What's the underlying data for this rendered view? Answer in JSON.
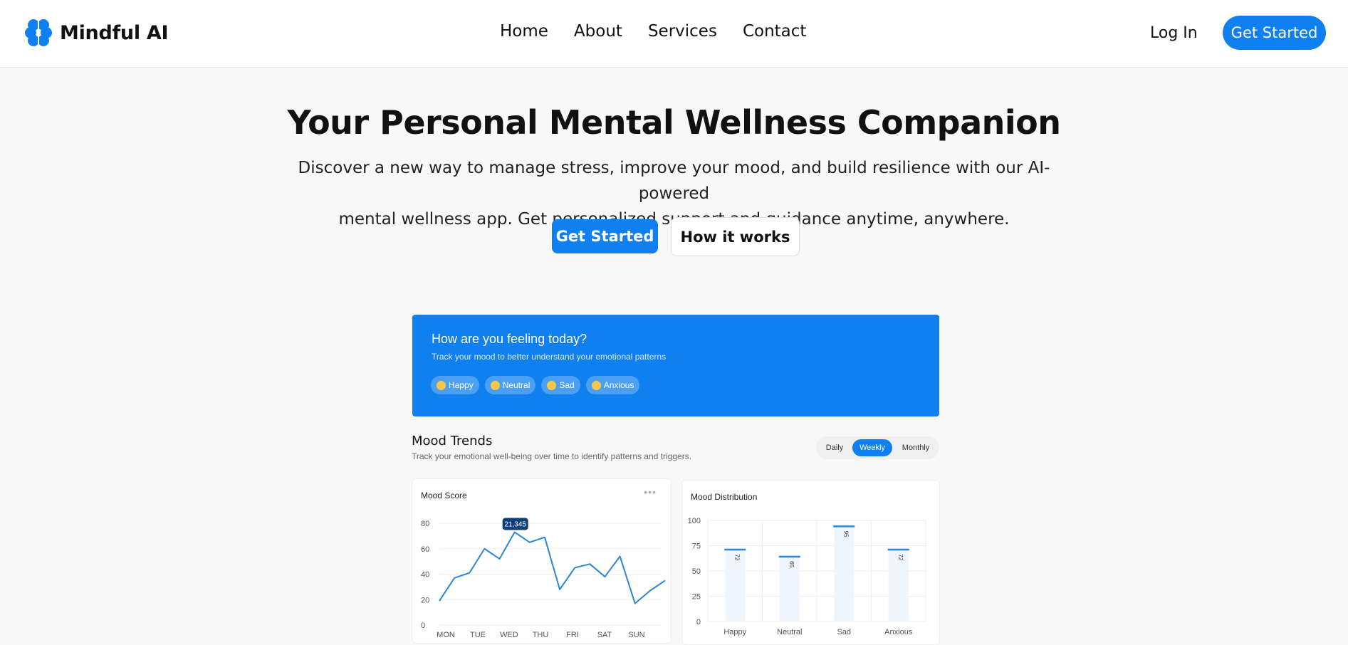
{
  "brand": {
    "name": "Mindful AI",
    "color": "#1080f0"
  },
  "nav": {
    "links": [
      "Home",
      "About",
      "Services",
      "Contact"
    ],
    "login": "Log In",
    "cta": "Get Started"
  },
  "hero": {
    "title": "Your Personal Mental Wellness Companion",
    "subtitle_line1": "Discover a new way to manage stress, improve your mood, and build resilience with our AI-powered",
    "subtitle_line2": "mental wellness app. Get personalized support and guidance anytime, anywhere.",
    "primary_button": "Get Started",
    "secondary_button": "How it works"
  },
  "mood_checkin": {
    "title": "How are you feeling today?",
    "subtitle": "Track your mood to better understand your emotional patterns",
    "options": [
      "Happy",
      "Neutral",
      "Sad",
      "Anxious"
    ]
  },
  "trends": {
    "title": "Mood Trends",
    "subtitle": "Track your emotional well-being over time to identify patterns and triggers.",
    "periods": [
      "Daily",
      "Weekly",
      "Monthly"
    ],
    "selected_period": "Weekly"
  },
  "chart_data": [
    {
      "type": "line",
      "title": "Mood Score",
      "ylim": [
        0,
        80
      ],
      "yticks": [
        0,
        20,
        40,
        60,
        80
      ],
      "xticks": [
        "MON",
        "TUE",
        "WED",
        "THU",
        "FRI",
        "SAT",
        "SUN"
      ],
      "tooltip": "21,345",
      "values": [
        19,
        37,
        41,
        60,
        52,
        73,
        65,
        69,
        28,
        45,
        48,
        38,
        54,
        17,
        27,
        35
      ],
      "grid": true
    },
    {
      "type": "bar",
      "title": "Mood Distribution",
      "categories": [
        "Happy",
        "Neutral",
        "Sad",
        "Anxious"
      ],
      "values": [
        72,
        65,
        95,
        72
      ],
      "ylim": [
        0,
        100
      ],
      "yticks": [
        0,
        25,
        50,
        75,
        100
      ],
      "grid": true
    }
  ]
}
